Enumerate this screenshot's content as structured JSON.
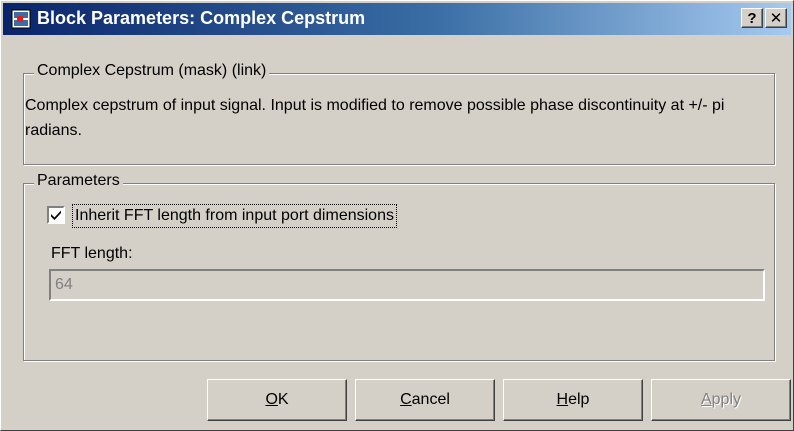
{
  "window": {
    "title": "Block Parameters: Complex Cepstrum",
    "help_glyph": "?",
    "close_glyph": "✕",
    "titlebar_colors": [
      "#0a246a",
      "#a6caf0"
    ]
  },
  "description_group": {
    "legend": "Complex Cepstrum (mask) (link)",
    "text": "Complex cepstrum of input signal.  Input is modified to remove possible phase discontinuity at +/- pi radians."
  },
  "parameters_group": {
    "legend": "Parameters",
    "inherit_checkbox": {
      "label": "Inherit FFT length from input port dimensions",
      "checked": true
    },
    "fft_length": {
      "label": "FFT length:",
      "value": "64",
      "enabled": false
    }
  },
  "buttons": {
    "ok": {
      "mnemonic": "O",
      "rest": "K"
    },
    "cancel": {
      "mnemonic": "C",
      "rest": "ancel"
    },
    "help": {
      "mnemonic": "H",
      "rest": "elp"
    },
    "apply": {
      "mnemonic": "A",
      "rest": "pply",
      "enabled": false
    }
  }
}
